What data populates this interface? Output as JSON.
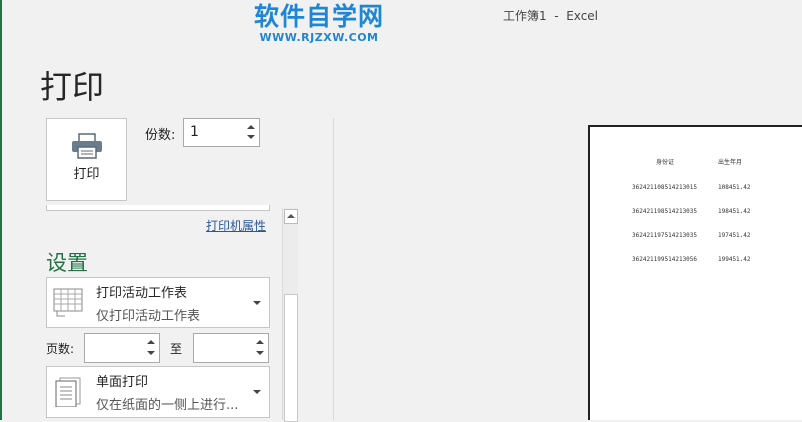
{
  "watermark": {
    "line1": "软件自学网",
    "line2": "WWW.RJZXW.COM"
  },
  "window_title": "工作簿1  -  Excel",
  "page_title": "打印",
  "print_button": {
    "label": "打印",
    "icon": "printer-icon"
  },
  "copies": {
    "label": "份数:",
    "value": "1"
  },
  "printer_properties_link": "打印机属性",
  "settings": {
    "heading": "设置",
    "print_what": {
      "title": "打印活动工作表",
      "subtitle": "仅打印活动工作表",
      "icon": "sheet-grid-icon"
    },
    "pages": {
      "label": "页数:",
      "to_label": "至",
      "from_value": "",
      "to_value": ""
    },
    "sides": {
      "title": "单面打印",
      "subtitle": "仅在纸面的一侧上进行...",
      "icon": "single-sided-page-icon"
    }
  },
  "preview": {
    "headers": [
      "身份证",
      "出生年月"
    ],
    "rows": [
      [
        "362421108514213015",
        "108451.42"
      ],
      [
        "362421198514213035",
        "198451.42"
      ],
      [
        "362421197514213035",
        "197451.42"
      ],
      [
        "362421199514213056",
        "199451.42"
      ]
    ]
  },
  "colors": {
    "accent": "#217346",
    "link": "#2b579a",
    "watermark": "#1f86d6"
  }
}
